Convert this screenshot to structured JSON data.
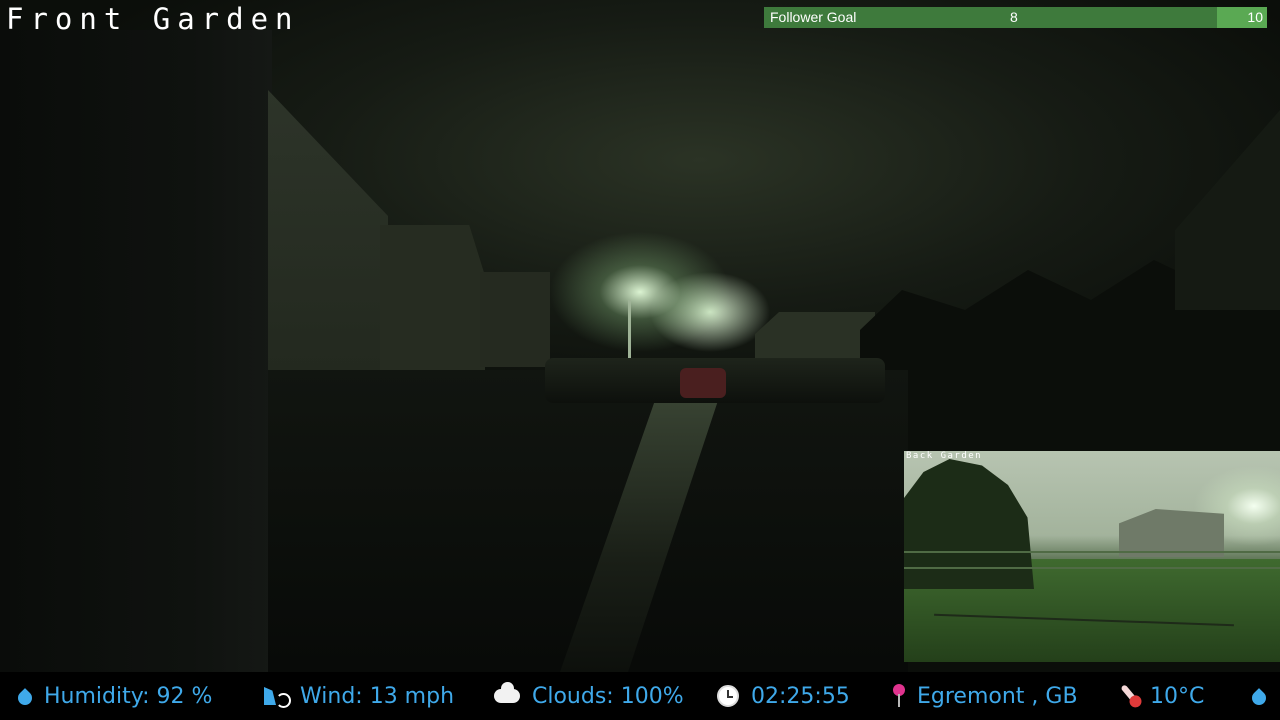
{
  "camera": {
    "title": "Front Garden"
  },
  "follower_goal": {
    "label": "Follower Goal",
    "current": "8",
    "target": "10",
    "progress_fraction": 0.8
  },
  "pip": {
    "title": "Back Garden"
  },
  "info_bar": {
    "humidity": {
      "icon": "water-drop-icon",
      "text": "Humidity: 92 %"
    },
    "wind": {
      "icon": "windsock-icon",
      "text": "Wind: 13 mph"
    },
    "clouds": {
      "icon": "cloud-icon",
      "text": "Clouds: 100%"
    },
    "time": {
      "icon": "clock-icon",
      "text": "02:25:55"
    },
    "location": {
      "icon": "map-pin-icon",
      "text": "Egremont , GB"
    },
    "temperature": {
      "icon": "thermometer-icon",
      "text": "10°C"
    },
    "trailing_icon": "water-drop-icon"
  },
  "colors": {
    "info_text": "#3fa9ea",
    "goal_bar": "#3e7a3c",
    "goal_target_segment": "#5aa953"
  }
}
